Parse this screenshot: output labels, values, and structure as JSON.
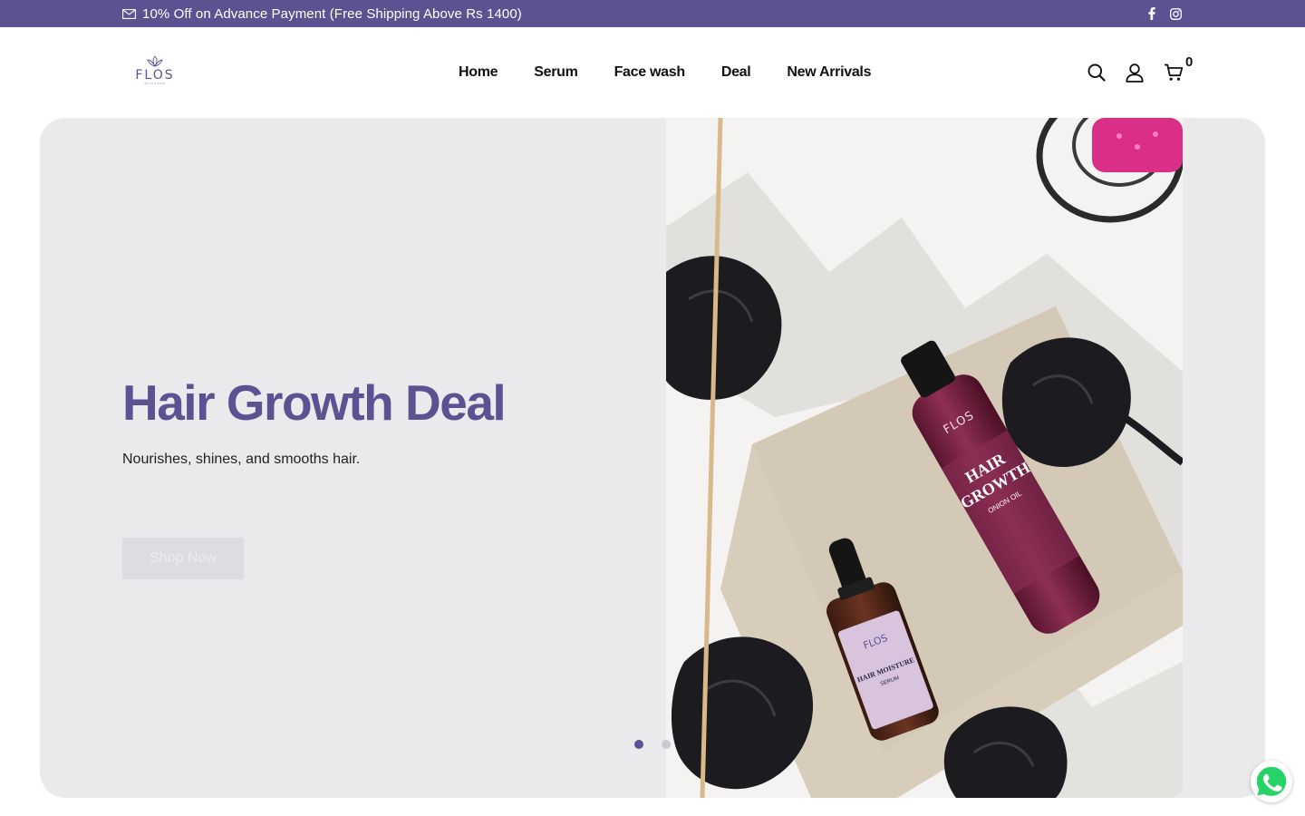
{
  "topbar": {
    "promo_text": "10% Off on Advance Payment (Free Shipping Above Rs 1400)",
    "mail_icon": "mail-icon",
    "social": [
      "facebook-icon",
      "instagram-icon"
    ]
  },
  "header": {
    "logo_text": "FLOS",
    "logo_subtext": "SKINCARE",
    "nav": [
      {
        "label": "Home"
      },
      {
        "label": "Serum"
      },
      {
        "label": "Face wash"
      },
      {
        "label": "Deal"
      },
      {
        "label": "New Arrivals"
      }
    ],
    "icons": [
      "search-icon",
      "user-icon",
      "cart-icon"
    ],
    "cart_count": "0"
  },
  "hero": {
    "title": "Hair Growth Deal",
    "subtitle": "Nourishes, shines, and smooths hair.",
    "button_label": "Shop Now",
    "slides": 2,
    "active_slide": 1,
    "product_labels": {
      "oil_brand": "FLOS",
      "oil_name_1": "HAIR",
      "oil_name_2": "GROWTH",
      "oil_type": "ONION OIL",
      "serum_brand": "FLOS",
      "serum_name": "HAIR MOISTURE",
      "serum_type": "SERUM"
    }
  },
  "colors": {
    "brand": "#5c5291",
    "hero_bg": "#eaeaec",
    "whatsapp": "#25d366"
  }
}
